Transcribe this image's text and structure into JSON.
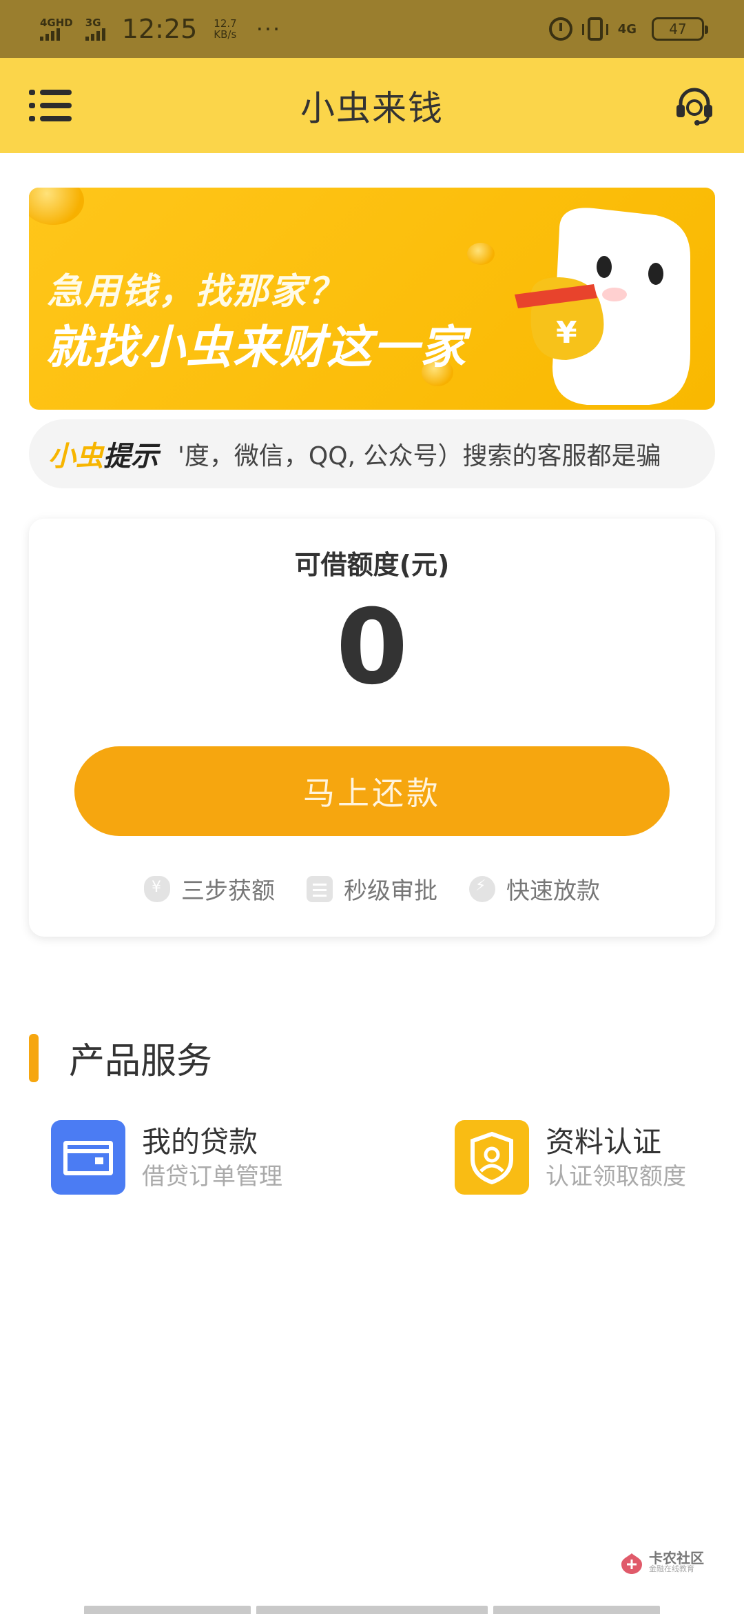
{
  "status_bar": {
    "sim1": "4GHD",
    "sim2": "3G",
    "time": "12:25",
    "speed_value": "12.7",
    "speed_unit": "KB/s",
    "more": "···",
    "network": "4G",
    "battery": "47"
  },
  "header": {
    "title": "小虫来钱"
  },
  "banner": {
    "line1": "急用钱，找那家？",
    "line2": "就找小虫来财这一家"
  },
  "notice": {
    "tag_part1": "小虫",
    "tag_part2": "提示",
    "message": "'度，微信，QQ, 公众号）搜索的客服都是骗"
  },
  "credit": {
    "label": "可借额度(元)",
    "amount": "0",
    "button_label": "马上还款",
    "features": [
      "三步获额",
      "秒级审批",
      "快速放款"
    ]
  },
  "services": {
    "section_title": "产品服务",
    "items": [
      {
        "title": "我的贷款",
        "subtitle": "借贷订单管理"
      },
      {
        "title": "资料认证",
        "subtitle": "认证领取额度"
      }
    ]
  },
  "watermark": {
    "name": "卡农社区",
    "tagline": "金融在线教育"
  },
  "colors": {
    "header_bg": "#fbd54a",
    "status_bg": "#9a7e2e",
    "accent": "#f6a60f",
    "loan_icon": "#4b7cf3",
    "verify_icon": "#f9bc14"
  }
}
